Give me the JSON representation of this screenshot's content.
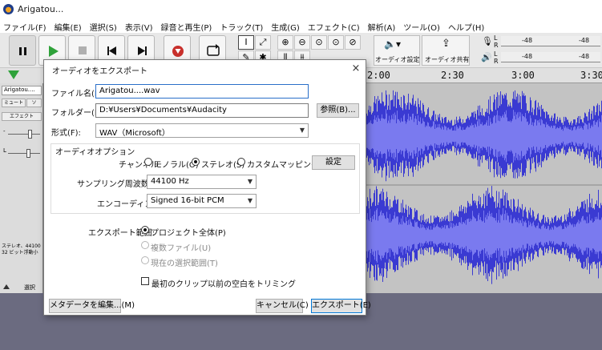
{
  "window": {
    "title": "Arigatou..."
  },
  "menu": [
    "ファイル(F)",
    "編集(E)",
    "選択(S)",
    "表示(V)",
    "録音と再生(P)",
    "トラック(T)",
    "生成(G)",
    "エフェクト(C)",
    "解析(A)",
    "ツール(O)",
    "ヘルプ(H)"
  ],
  "toolbar": {
    "audio_setup": "オーディオ設定",
    "share_audio": "オーディオ共有",
    "meter_scale": "-48",
    "meter_l": "L",
    "meter_r": "R"
  },
  "timeline": {
    "ticks": [
      "2:00",
      "2:30",
      "3:00",
      "3:30"
    ]
  },
  "track": {
    "name": "Arigatou....",
    "mute": "ミュート",
    "solo": "ソ",
    "effects": "エフェクト",
    "gain_left": "-",
    "gain_right": "+",
    "pan_left": "L",
    "pan_right": "R",
    "info_line1": "ステレオ、44100",
    "info_line2": "32 ビット浮動小",
    "select": "選択"
  },
  "dialog": {
    "title": "オーディオをエクスポート",
    "close": "×",
    "filename_label": "ファイル名(N):",
    "filename_value": "Arigatou....wav",
    "folder_label": "フォルダー(L):",
    "folder_value": "D:¥Users¥Documents¥Audacity",
    "browse_button": "参照(B)...",
    "format_label": "形式(F):",
    "format_value": "WAV（Microsoft）",
    "audio_options_title": "オーディオオプション",
    "channel_label": "チャンネル",
    "channel_options": [
      "モノラル(O)",
      "ステレオ(S)",
      "カスタムマッピング(G)"
    ],
    "channel_selected": 1,
    "settings_button": "設定",
    "sample_rate_label": "サンプリング周波数(R)",
    "sample_rate_value": "44100 Hz",
    "encoding_label": "エンコーディング",
    "encoding_value": "Signed 16-bit PCM",
    "export_range_label": "エクスポート範囲:",
    "export_range_options": [
      "プロジェクト全体(P)",
      "複数ファイル(U)",
      "現在の選択範囲(T)"
    ],
    "trim_label": "最初のクリップ以前の空白をトリミング",
    "metadata_button": "メタデータを編集...(M)",
    "cancel_button": "キャンセル(C)",
    "export_button": "エクスポート(E)"
  },
  "colors": {
    "waveform": "#3a3ad2",
    "waveform_rms": "#7a7aef",
    "wave_bg": "#c3c3c3",
    "play": "#2fa23a",
    "record": "#c8302c"
  }
}
